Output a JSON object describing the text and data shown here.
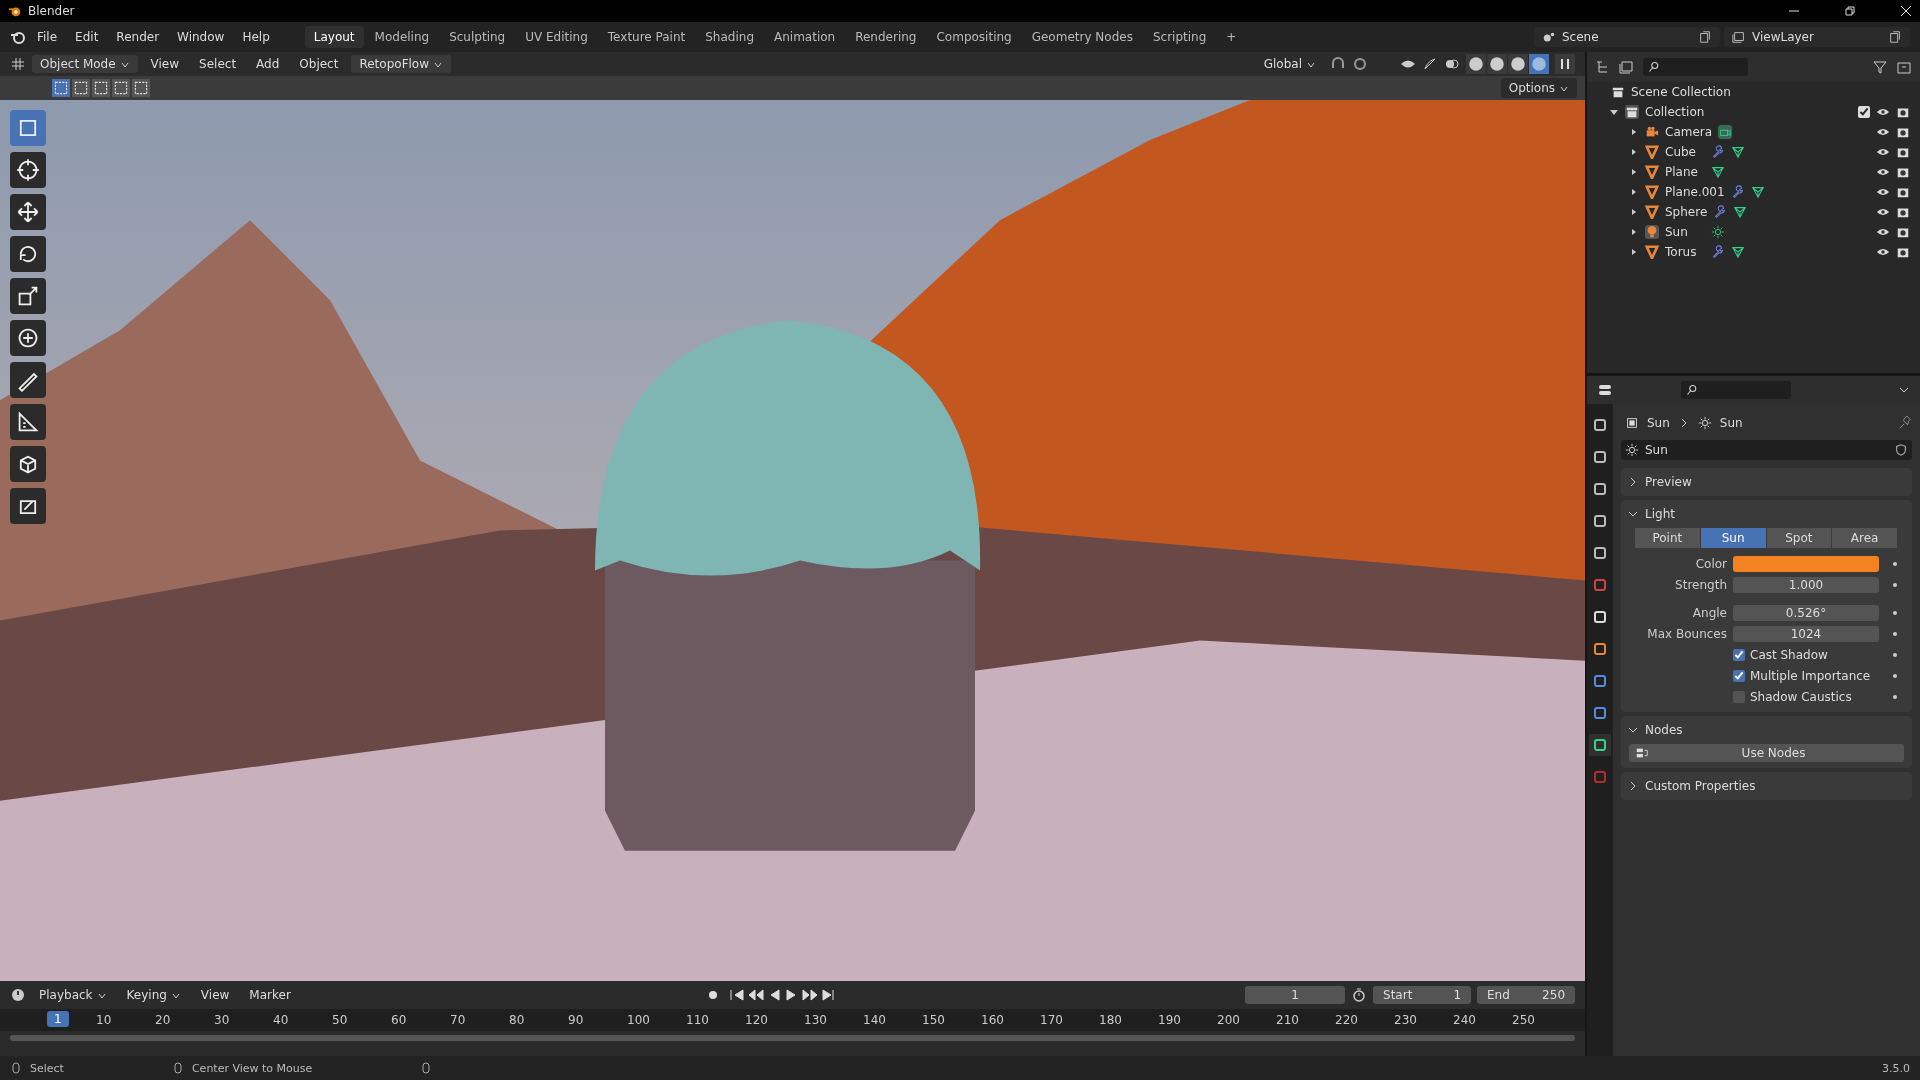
{
  "window": {
    "title": "Blender"
  },
  "menu": [
    "File",
    "Edit",
    "Render",
    "Window",
    "Help"
  ],
  "workspaces": [
    {
      "label": "Layout",
      "selected": true
    },
    {
      "label": "Modeling",
      "selected": false
    },
    {
      "label": "Sculpting",
      "selected": false
    },
    {
      "label": "UV Editing",
      "selected": false
    },
    {
      "label": "Texture Paint",
      "selected": false
    },
    {
      "label": "Shading",
      "selected": false
    },
    {
      "label": "Animation",
      "selected": false
    },
    {
      "label": "Rendering",
      "selected": false
    },
    {
      "label": "Compositing",
      "selected": false
    },
    {
      "label": "Geometry Nodes",
      "selected": false
    },
    {
      "label": "Scripting",
      "selected": false
    },
    {
      "label": "+",
      "selected": false
    }
  ],
  "scene": {
    "name": "Scene",
    "view_layer": "ViewLayer"
  },
  "viewport": {
    "mode": "Object Mode",
    "menus": [
      "View",
      "Select",
      "Add",
      "Object"
    ],
    "addon": "RetopoFlow",
    "orientation": "Global",
    "options": "Options",
    "select_modes": [
      {
        "selected": true
      },
      {
        "selected": false
      },
      {
        "selected": false
      },
      {
        "selected": false
      },
      {
        "selected": false
      }
    ],
    "shading": [
      {
        "selected": false
      },
      {
        "selected": false
      },
      {
        "selected": false
      },
      {
        "selected": true
      }
    ],
    "tools": [
      {
        "kind": "select",
        "selected": true
      },
      {
        "kind": "cursor",
        "selected": false
      },
      {
        "kind": "move",
        "selected": false
      },
      {
        "kind": "rotate",
        "selected": false
      },
      {
        "kind": "scale",
        "selected": false
      },
      {
        "kind": "transform",
        "selected": false
      },
      {
        "kind": "annotate",
        "selected": false
      },
      {
        "kind": "measure",
        "selected": false
      },
      {
        "kind": "cube",
        "selected": false
      },
      {
        "kind": "extrude",
        "selected": false
      }
    ]
  },
  "outliner": {
    "root": "Scene Collection",
    "collection": {
      "name": "Collection",
      "expanded": true,
      "checked": true,
      "children": [
        {
          "name": "Camera",
          "kind": "camera",
          "modifier": false
        },
        {
          "name": "Cube",
          "kind": "mesh",
          "modifier": true
        },
        {
          "name": "Plane",
          "kind": "mesh",
          "modifier": false
        },
        {
          "name": "Plane.001",
          "kind": "mesh",
          "modifier": true
        },
        {
          "name": "Sphere",
          "kind": "mesh",
          "modifier": true
        },
        {
          "name": "Sun",
          "kind": "light",
          "modifier": false
        },
        {
          "name": "Torus",
          "kind": "mesh",
          "modifier": true
        }
      ]
    }
  },
  "properties": {
    "tabs": [
      {
        "kind": "tool",
        "selected": false
      },
      {
        "kind": "render",
        "selected": false
      },
      {
        "kind": "output",
        "selected": false
      },
      {
        "kind": "view_layer",
        "selected": false
      },
      {
        "kind": "scene",
        "selected": false
      },
      {
        "kind": "world",
        "selected": false
      },
      {
        "kind": "collection",
        "selected": false
      },
      {
        "kind": "object",
        "selected": false
      },
      {
        "kind": "physics",
        "selected": false
      },
      {
        "kind": "constraints",
        "selected": false
      },
      {
        "kind": "data",
        "selected": true
      },
      {
        "kind": "texture",
        "selected": false
      }
    ],
    "breadcrumb": [
      "Sun",
      "Sun"
    ],
    "datablock": "Sun",
    "panels": [
      {
        "title": "Preview",
        "expanded": false
      },
      {
        "title": "Light",
        "expanded": true,
        "light_types": [
          {
            "label": "Point",
            "selected": false
          },
          {
            "label": "Sun",
            "selected": true
          },
          {
            "label": "Spot",
            "selected": false
          },
          {
            "label": "Area",
            "selected": false
          }
        ],
        "fields": [
          {
            "kind": "color",
            "label": "Color",
            "color": "#f58220"
          },
          {
            "kind": "number",
            "label": "Strength",
            "value": "1.000"
          },
          {
            "kind": "number",
            "label": "Angle",
            "value": "0.526°"
          },
          {
            "kind": "number",
            "label": "Max Bounces",
            "value": "1024"
          },
          {
            "kind": "checkbox",
            "label": "Cast Shadow",
            "checked": true
          },
          {
            "kind": "checkbox",
            "label": "Multiple Importance",
            "checked": true
          },
          {
            "kind": "checkbox",
            "label": "Shadow Caustics",
            "checked": false
          }
        ]
      },
      {
        "title": "Nodes",
        "expanded": true,
        "button": "Use Nodes"
      },
      {
        "title": "Custom Properties",
        "expanded": false
      }
    ]
  },
  "timeline": {
    "menus": [
      "Playback",
      "Keying",
      "View",
      "Marker"
    ],
    "frame": "1",
    "start_label": "Start",
    "start": "1",
    "end_label": "End",
    "end": "250",
    "current": "1",
    "ticks": [
      "10",
      "20",
      "30",
      "40",
      "50",
      "60",
      "70",
      "80",
      "90",
      "100",
      "110",
      "120",
      "130",
      "140",
      "150",
      "160",
      "170",
      "180",
      "190",
      "200",
      "210",
      "220",
      "230",
      "240",
      "250"
    ]
  },
  "status_bar": {
    "items": [
      "Select",
      "Center View to Mouse"
    ],
    "version": "3.5.0"
  }
}
